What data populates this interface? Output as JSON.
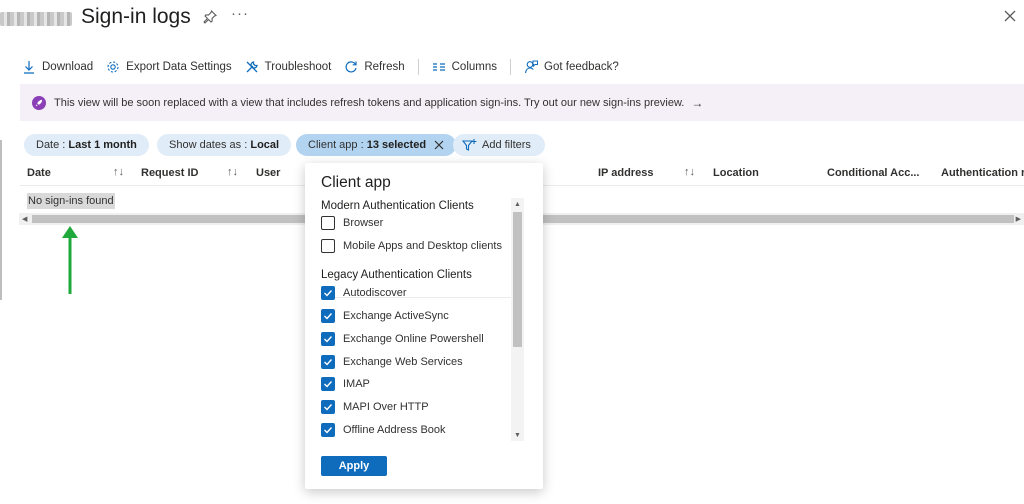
{
  "header": {
    "title": "Sign-in logs",
    "more_label": "···"
  },
  "toolbar": {
    "download": "Download",
    "export": "Export Data Settings",
    "troubleshoot": "Troubleshoot",
    "refresh": "Refresh",
    "columns": "Columns",
    "feedback": "Got feedback?"
  },
  "banner": {
    "text": "This view will be soon replaced with a view that includes refresh tokens and application sign-ins. Try out our new sign-ins preview.",
    "arrow": "→"
  },
  "filters": {
    "date_key": "Date : ",
    "date_value": "Last 1 month",
    "show_dates_key": "Show dates as : ",
    "show_dates_value": "Local",
    "client_app_key": "Client app : ",
    "client_app_value": "13 selected",
    "add_filters": "Add filters"
  },
  "table": {
    "columns": [
      "Date",
      "Request ID",
      "User",
      "IP address",
      "Location",
      "Conditional Acc...",
      "Authentication r..."
    ],
    "sort_glyph": "↑↓",
    "empty_message": "No sign-ins found"
  },
  "dropdown": {
    "title": "Client app",
    "groups": [
      {
        "label": "Modern Authentication Clients",
        "options": [
          {
            "label": "Browser",
            "checked": false
          },
          {
            "label": "Mobile Apps and Desktop clients",
            "checked": false
          }
        ]
      },
      {
        "label": "Legacy Authentication Clients",
        "options": [
          {
            "label": "Autodiscover",
            "checked": true
          },
          {
            "label": "Exchange ActiveSync",
            "checked": true
          },
          {
            "label": "Exchange Online Powershell",
            "checked": true
          },
          {
            "label": "Exchange Web Services",
            "checked": true
          },
          {
            "label": "IMAP",
            "checked": true
          },
          {
            "label": "MAPI Over HTTP",
            "checked": true
          },
          {
            "label": "Offline Address Book",
            "checked": true
          }
        ]
      }
    ],
    "apply_label": "Apply"
  },
  "colors": {
    "accent": "#0f6cbd",
    "banner_bg": "#f5f0f8",
    "banner_icon": "#8a3fb6",
    "pill_bg": "#e0ecf7",
    "annotation_arrow": "#1fa83b"
  },
  "icons": [
    "download-icon",
    "gear-icon",
    "wrench-icon",
    "refresh-icon",
    "columns-icon",
    "feedback-icon",
    "pin-icon",
    "close-icon",
    "rocket-icon",
    "filter-add-icon"
  ]
}
